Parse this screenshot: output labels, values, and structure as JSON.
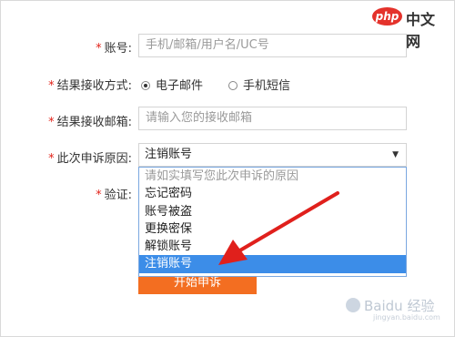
{
  "logo": {
    "badge": "php",
    "text": "中文网"
  },
  "form": {
    "account": {
      "label": "账号:",
      "placeholder": "手机/邮箱/用户名/UC号"
    },
    "receive_method": {
      "label": "结果接收方式:",
      "options": [
        {
          "label": "电子邮件",
          "selected": true
        },
        {
          "label": "手机短信",
          "selected": false
        }
      ]
    },
    "email": {
      "label": "结果接收邮箱:",
      "placeholder": "请输入您的接收邮箱"
    },
    "reason": {
      "label": "此次申诉原因:",
      "selected_value": "注销账号",
      "options": [
        "请如实填写您此次申诉的原因",
        "忘记密码",
        "账号被盗",
        "更换密保",
        "解锁账号",
        "注销账号"
      ],
      "highlighted_index": 5
    },
    "verify": {
      "label": "验证:"
    },
    "submit_label": "开始申诉",
    "required_mark": "*"
  },
  "watermark": {
    "text": "Baidu 经验",
    "subtext": "jingyan.baidu.com"
  },
  "colors": {
    "accent": "#f36e21",
    "selection": "#3c8de8",
    "arrow": "#e0201c",
    "required": "#e2231a"
  }
}
